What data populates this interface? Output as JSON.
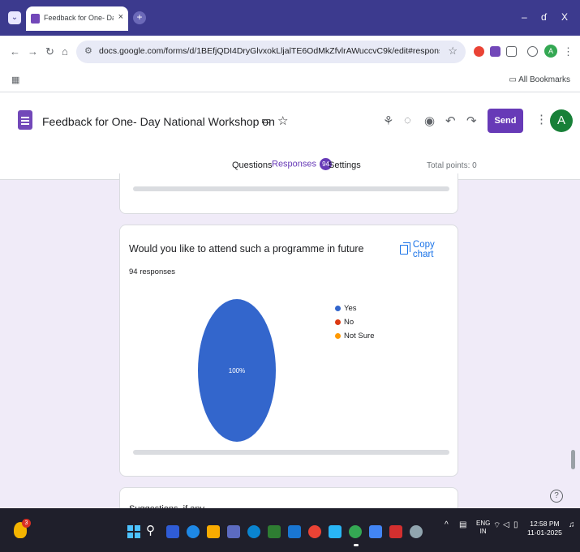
{
  "browser": {
    "tab_title": "Feedback for One- Day National",
    "tab_close": "×",
    "new_tab": "+",
    "minimize": "–",
    "maximize": "ɗ",
    "close": "X",
    "url": "docs.google.com/forms/d/1BEfjQDI4DryGlvxokLljalTE6OdMkZfvlrAWuccvC9k/edit#responses",
    "bookmarks_label": "All Bookmarks"
  },
  "header": {
    "title": "Feedback for  One- Day National Workshop on Strengthening",
    "send_label": "Send",
    "avatar_letter": "A",
    "tabs": [
      {
        "label": "Questions"
      },
      {
        "label": "Responses",
        "badge": "94"
      },
      {
        "label": "Settings"
      }
    ],
    "total_points": "Total points: 0"
  },
  "question_card": {
    "question": "Would you like to attend such a programme in future",
    "responses": "94 responses",
    "copy_chart": "Copy chart"
  },
  "chart_data": {
    "type": "pie",
    "slices": [
      {
        "label": "Yes",
        "value": 100,
        "color": "#3366cc"
      },
      {
        "label": "No",
        "value": 0,
        "color": "#dc3912"
      },
      {
        "label": "Not Sure",
        "value": 0,
        "color": "#ff9900"
      }
    ],
    "slice_label": "100%",
    "legend_position": "right"
  },
  "next_card": {
    "title": "Suggestions, if any"
  },
  "help": "?",
  "taskbar": {
    "notification_count": "3",
    "lang_top": "ENG",
    "lang_bottom": "IN",
    "time": "12:58 PM",
    "date": "11-01-2025"
  }
}
